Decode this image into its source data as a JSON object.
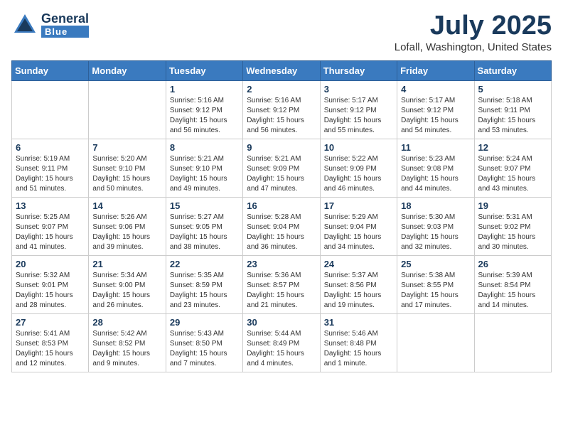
{
  "header": {
    "logo_general": "General",
    "logo_blue": "Blue",
    "month": "July 2025",
    "location": "Lofall, Washington, United States"
  },
  "weekdays": [
    "Sunday",
    "Monday",
    "Tuesday",
    "Wednesday",
    "Thursday",
    "Friday",
    "Saturday"
  ],
  "weeks": [
    [
      {
        "day": "",
        "content": ""
      },
      {
        "day": "",
        "content": ""
      },
      {
        "day": "1",
        "content": "Sunrise: 5:16 AM\nSunset: 9:12 PM\nDaylight: 15 hours and 56 minutes."
      },
      {
        "day": "2",
        "content": "Sunrise: 5:16 AM\nSunset: 9:12 PM\nDaylight: 15 hours and 56 minutes."
      },
      {
        "day": "3",
        "content": "Sunrise: 5:17 AM\nSunset: 9:12 PM\nDaylight: 15 hours and 55 minutes."
      },
      {
        "day": "4",
        "content": "Sunrise: 5:17 AM\nSunset: 9:12 PM\nDaylight: 15 hours and 54 minutes."
      },
      {
        "day": "5",
        "content": "Sunrise: 5:18 AM\nSunset: 9:11 PM\nDaylight: 15 hours and 53 minutes."
      }
    ],
    [
      {
        "day": "6",
        "content": "Sunrise: 5:19 AM\nSunset: 9:11 PM\nDaylight: 15 hours and 51 minutes."
      },
      {
        "day": "7",
        "content": "Sunrise: 5:20 AM\nSunset: 9:10 PM\nDaylight: 15 hours and 50 minutes."
      },
      {
        "day": "8",
        "content": "Sunrise: 5:21 AM\nSunset: 9:10 PM\nDaylight: 15 hours and 49 minutes."
      },
      {
        "day": "9",
        "content": "Sunrise: 5:21 AM\nSunset: 9:09 PM\nDaylight: 15 hours and 47 minutes."
      },
      {
        "day": "10",
        "content": "Sunrise: 5:22 AM\nSunset: 9:09 PM\nDaylight: 15 hours and 46 minutes."
      },
      {
        "day": "11",
        "content": "Sunrise: 5:23 AM\nSunset: 9:08 PM\nDaylight: 15 hours and 44 minutes."
      },
      {
        "day": "12",
        "content": "Sunrise: 5:24 AM\nSunset: 9:07 PM\nDaylight: 15 hours and 43 minutes."
      }
    ],
    [
      {
        "day": "13",
        "content": "Sunrise: 5:25 AM\nSunset: 9:07 PM\nDaylight: 15 hours and 41 minutes."
      },
      {
        "day": "14",
        "content": "Sunrise: 5:26 AM\nSunset: 9:06 PM\nDaylight: 15 hours and 39 minutes."
      },
      {
        "day": "15",
        "content": "Sunrise: 5:27 AM\nSunset: 9:05 PM\nDaylight: 15 hours and 38 minutes."
      },
      {
        "day": "16",
        "content": "Sunrise: 5:28 AM\nSunset: 9:04 PM\nDaylight: 15 hours and 36 minutes."
      },
      {
        "day": "17",
        "content": "Sunrise: 5:29 AM\nSunset: 9:04 PM\nDaylight: 15 hours and 34 minutes."
      },
      {
        "day": "18",
        "content": "Sunrise: 5:30 AM\nSunset: 9:03 PM\nDaylight: 15 hours and 32 minutes."
      },
      {
        "day": "19",
        "content": "Sunrise: 5:31 AM\nSunset: 9:02 PM\nDaylight: 15 hours and 30 minutes."
      }
    ],
    [
      {
        "day": "20",
        "content": "Sunrise: 5:32 AM\nSunset: 9:01 PM\nDaylight: 15 hours and 28 minutes."
      },
      {
        "day": "21",
        "content": "Sunrise: 5:34 AM\nSunset: 9:00 PM\nDaylight: 15 hours and 26 minutes."
      },
      {
        "day": "22",
        "content": "Sunrise: 5:35 AM\nSunset: 8:59 PM\nDaylight: 15 hours and 23 minutes."
      },
      {
        "day": "23",
        "content": "Sunrise: 5:36 AM\nSunset: 8:57 PM\nDaylight: 15 hours and 21 minutes."
      },
      {
        "day": "24",
        "content": "Sunrise: 5:37 AM\nSunset: 8:56 PM\nDaylight: 15 hours and 19 minutes."
      },
      {
        "day": "25",
        "content": "Sunrise: 5:38 AM\nSunset: 8:55 PM\nDaylight: 15 hours and 17 minutes."
      },
      {
        "day": "26",
        "content": "Sunrise: 5:39 AM\nSunset: 8:54 PM\nDaylight: 15 hours and 14 minutes."
      }
    ],
    [
      {
        "day": "27",
        "content": "Sunrise: 5:41 AM\nSunset: 8:53 PM\nDaylight: 15 hours and 12 minutes."
      },
      {
        "day": "28",
        "content": "Sunrise: 5:42 AM\nSunset: 8:52 PM\nDaylight: 15 hours and 9 minutes."
      },
      {
        "day": "29",
        "content": "Sunrise: 5:43 AM\nSunset: 8:50 PM\nDaylight: 15 hours and 7 minutes."
      },
      {
        "day": "30",
        "content": "Sunrise: 5:44 AM\nSunset: 8:49 PM\nDaylight: 15 hours and 4 minutes."
      },
      {
        "day": "31",
        "content": "Sunrise: 5:46 AM\nSunset: 8:48 PM\nDaylight: 15 hours and 1 minute."
      },
      {
        "day": "",
        "content": ""
      },
      {
        "day": "",
        "content": ""
      }
    ]
  ]
}
